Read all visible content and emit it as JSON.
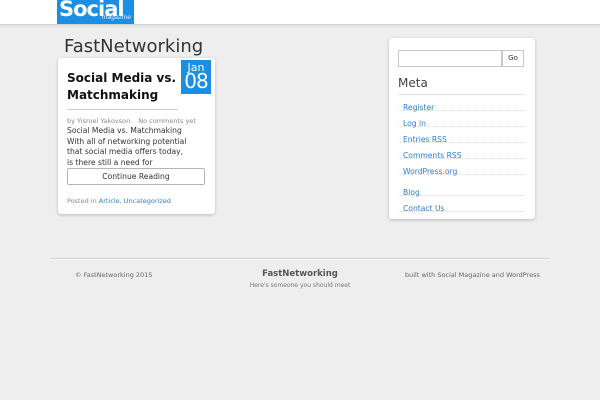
{
  "header": {
    "logo_text": "Social",
    "logo_subtext": "magazine"
  },
  "site": {
    "title": "FastNetworking"
  },
  "post": {
    "title": "Social Media vs. Matchmaking",
    "date_month": "Jan",
    "date_day": "08",
    "author": "by Yisroel Yakovson",
    "comments": "No comments yet",
    "excerpt_line1": "Social Media vs. Matchmaking",
    "excerpt_line2": "With all of networking potential that social media offers today, is there still a need for",
    "continue_label": "Continue Reading",
    "posted_in_label": "Posted in",
    "categories": [
      "Article",
      "Uncategorized"
    ]
  },
  "sidebar": {
    "search_placeholder": "",
    "search_button": "Go",
    "meta_heading": "Meta",
    "meta_links": [
      "Register",
      "Log in",
      "Entries RSS",
      "Comments RSS",
      "WordPress.org"
    ],
    "extra_links": [
      "Blog",
      "Contact Us"
    ]
  },
  "footer": {
    "copyright": "© FastNetworking 2015",
    "title": "FastNetworking",
    "tagline": "Here's someone you should meet",
    "credits": "built with Social Magazine and WordPress"
  },
  "colors": {
    "accent": "#1a8fe3",
    "link": "#2a7fd0",
    "background": "#eeeeee"
  }
}
